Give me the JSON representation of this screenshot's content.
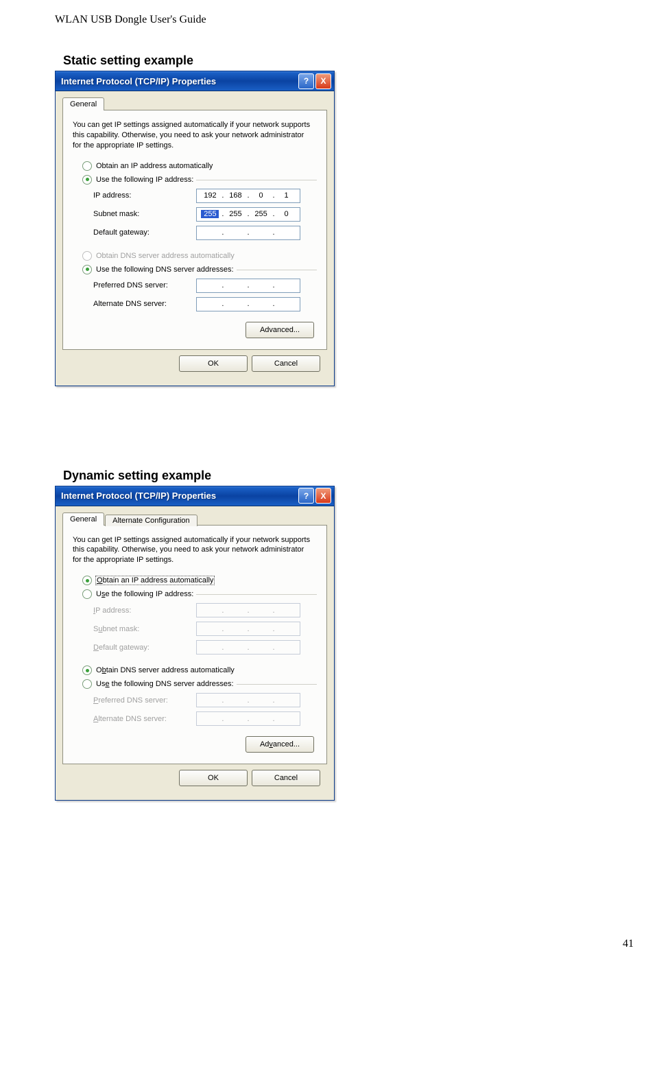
{
  "doc_header": "WLAN USB Dongle User's Guide",
  "page_number": "41",
  "section1_title": "Static setting example",
  "section2_title": "Dynamic setting example",
  "dialog": {
    "title": "Internet Protocol (TCP/IP) Properties",
    "help_char": "?",
    "close_char": "X",
    "tab_general": "General",
    "tab_alternate": "Alternate Configuration",
    "description": "You can get IP settings assigned automatically if your network supports this capability. Otherwise, you need to ask your network administrator for the appropriate IP settings.",
    "radio_obtain_auto": "Obtain an IP address automatically",
    "radio_obtain_auto_u": "O",
    "radio_obtain_auto_rest": "btain an IP address automatically",
    "radio_use_ip": "Use the following IP address:",
    "radio_use_ip_u": "s",
    "radio_use_ip_pre": "U",
    "radio_use_ip_post": "e the following IP address:",
    "lbl_ip": "IP address:",
    "lbl_ip_u": "I",
    "lbl_ip_rest": "P address:",
    "lbl_subnet": "Subnet mask:",
    "lbl_subnet_u": "S",
    "lbl_subnet_pre": "",
    "lbl_subnet_mid": "u",
    "lbl_subnet_rest": "bnet mask:",
    "lbl_gw": "Default gateway:",
    "lbl_gw_u": "D",
    "lbl_gw_rest": "efault gateway:",
    "radio_dns_auto": "Obtain DNS server address automatically",
    "radio_dns_auto_u": "b",
    "radio_dns_auto_pre": "O",
    "radio_dns_auto_post": "tain DNS server address automatically",
    "radio_dns_use": "Use the following DNS server addresses:",
    "radio_dns_use_u": "e",
    "radio_dns_use_pre": "Us",
    "radio_dns_use_post": " the following DNS server addresses:",
    "lbl_pref_dns": "Preferred DNS server:",
    "lbl_pref_dns_u": "P",
    "lbl_pref_dns_rest": "referred DNS server:",
    "lbl_alt_dns": "Alternate DNS server:",
    "lbl_alt_dns_u": "A",
    "lbl_alt_dns_rest": "lternate DNS server:",
    "btn_advanced": "Advanced...",
    "btn_advanced_u": "v",
    "btn_advanced_pre": "Ad",
    "btn_advanced_post": "anced...",
    "btn_ok": "OK",
    "btn_cancel": "Cancel",
    "static_ip": {
      "o1": "192",
      "o2": "168",
      "o3": "0",
      "o4": "1"
    },
    "static_mask": {
      "o1": "255",
      "o2": "255",
      "o3": "255",
      "o4": "0"
    }
  }
}
